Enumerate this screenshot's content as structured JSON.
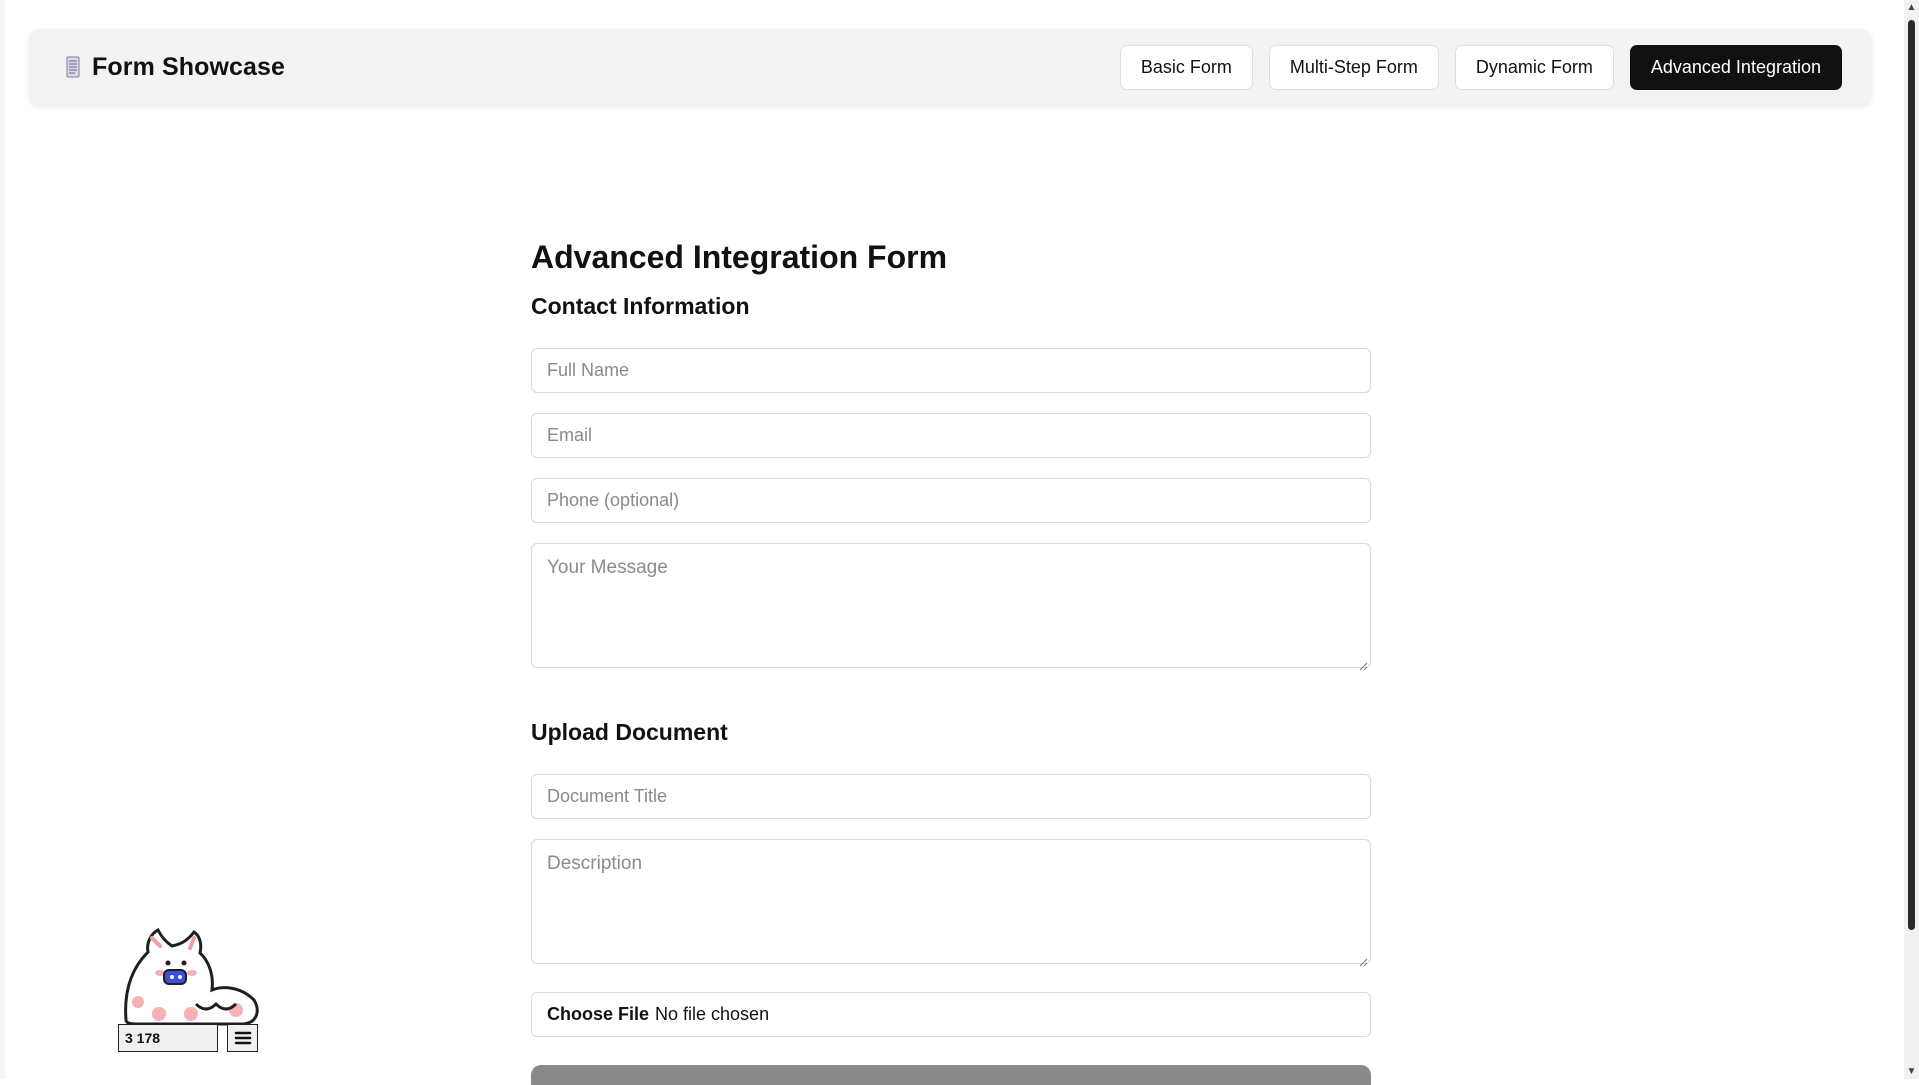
{
  "brand": {
    "title": "Form Showcase",
    "icon": "document-icon"
  },
  "nav": {
    "tabs": [
      {
        "label": "Basic Form",
        "active": false
      },
      {
        "label": "Multi-Step Form",
        "active": false
      },
      {
        "label": "Dynamic Form",
        "active": false
      },
      {
        "label": "Advanced Integration",
        "active": true
      }
    ]
  },
  "form": {
    "title": "Advanced Integration Form",
    "contact_section": {
      "title": "Contact Information",
      "full_name": {
        "placeholder": "Full Name",
        "value": ""
      },
      "email": {
        "placeholder": "Email",
        "value": ""
      },
      "phone": {
        "placeholder": "Phone (optional)",
        "value": ""
      },
      "message": {
        "placeholder": "Your Message",
        "value": ""
      }
    },
    "upload_section": {
      "title": "Upload Document",
      "document_title": {
        "placeholder": "Document Title",
        "value": ""
      },
      "description": {
        "placeholder": "Description",
        "value": ""
      },
      "file": {
        "button_label": "Choose File",
        "status": "No file chosen"
      }
    }
  },
  "widget": {
    "counter": "3 178",
    "menu_icon": "hamburger-menu-icon",
    "mascot_icon": "cat-mascot-icon"
  },
  "colors": {
    "active_tab_bg": "#111111",
    "nav_bg": "#f3f3f3",
    "border": "#d9d9d9",
    "placeholder": "#8a8a8a",
    "submit_button": "#8a8a8a"
  }
}
